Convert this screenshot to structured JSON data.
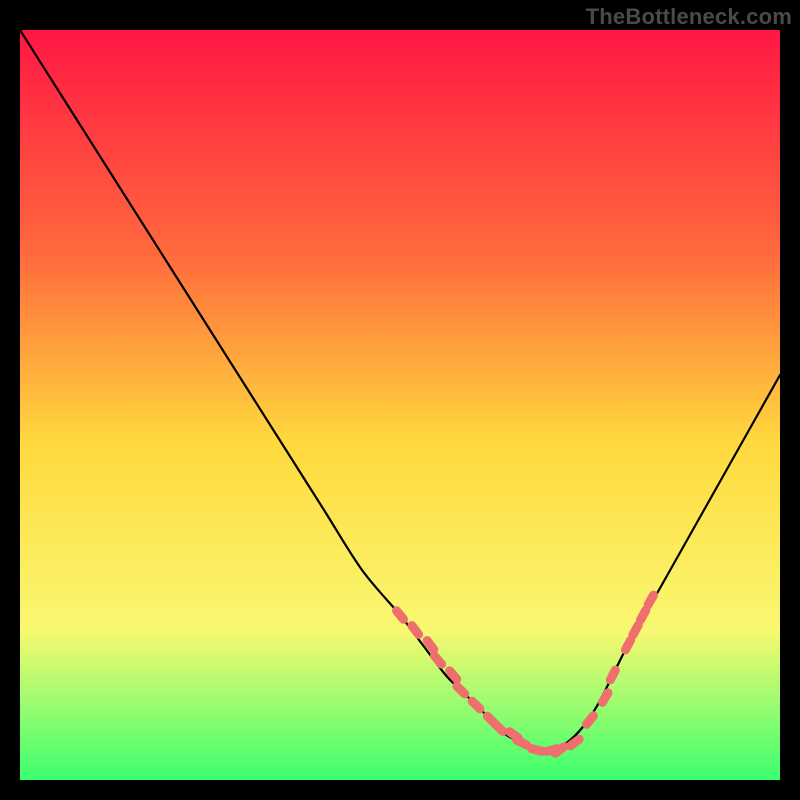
{
  "watermark": "TheBottleneck.com",
  "chart_data": {
    "type": "line",
    "title": "",
    "xlabel": "",
    "ylabel": "",
    "xlim": [
      0,
      100
    ],
    "ylim": [
      0,
      100
    ],
    "gradient_colors": {
      "top": "#ff1744",
      "mid_upper": "#ff6a3d",
      "mid": "#ffd93d",
      "mid_lower": "#f9f871",
      "bottom": "#3bff6e"
    },
    "series": [
      {
        "name": "bottleneck-curve",
        "x": [
          0,
          5,
          10,
          15,
          20,
          25,
          30,
          35,
          40,
          45,
          50,
          53,
          56,
          58,
          60,
          62,
          64,
          66,
          68,
          70,
          72,
          74,
          76,
          78,
          80,
          85,
          90,
          95,
          100
        ],
        "values": [
          100,
          92,
          84,
          76,
          68,
          60,
          52,
          44,
          36,
          28,
          22,
          18,
          14,
          12,
          10,
          8,
          6,
          5,
          4,
          4,
          5,
          7,
          10,
          14,
          18,
          27,
          36,
          45,
          54
        ]
      },
      {
        "name": "highlight-points",
        "x": [
          50,
          52,
          54,
          55,
          57,
          58,
          60,
          62,
          63,
          65,
          66,
          68,
          70,
          71,
          73,
          75,
          77,
          78,
          80,
          81,
          82,
          83
        ],
        "values": [
          22,
          20,
          18,
          16,
          14,
          12,
          10,
          8,
          7,
          6,
          5,
          4,
          4,
          4,
          5,
          8,
          11,
          14,
          18,
          20,
          22,
          24
        ]
      }
    ],
    "marker_color": "#ef6e6e",
    "curve_color": "#000000"
  }
}
